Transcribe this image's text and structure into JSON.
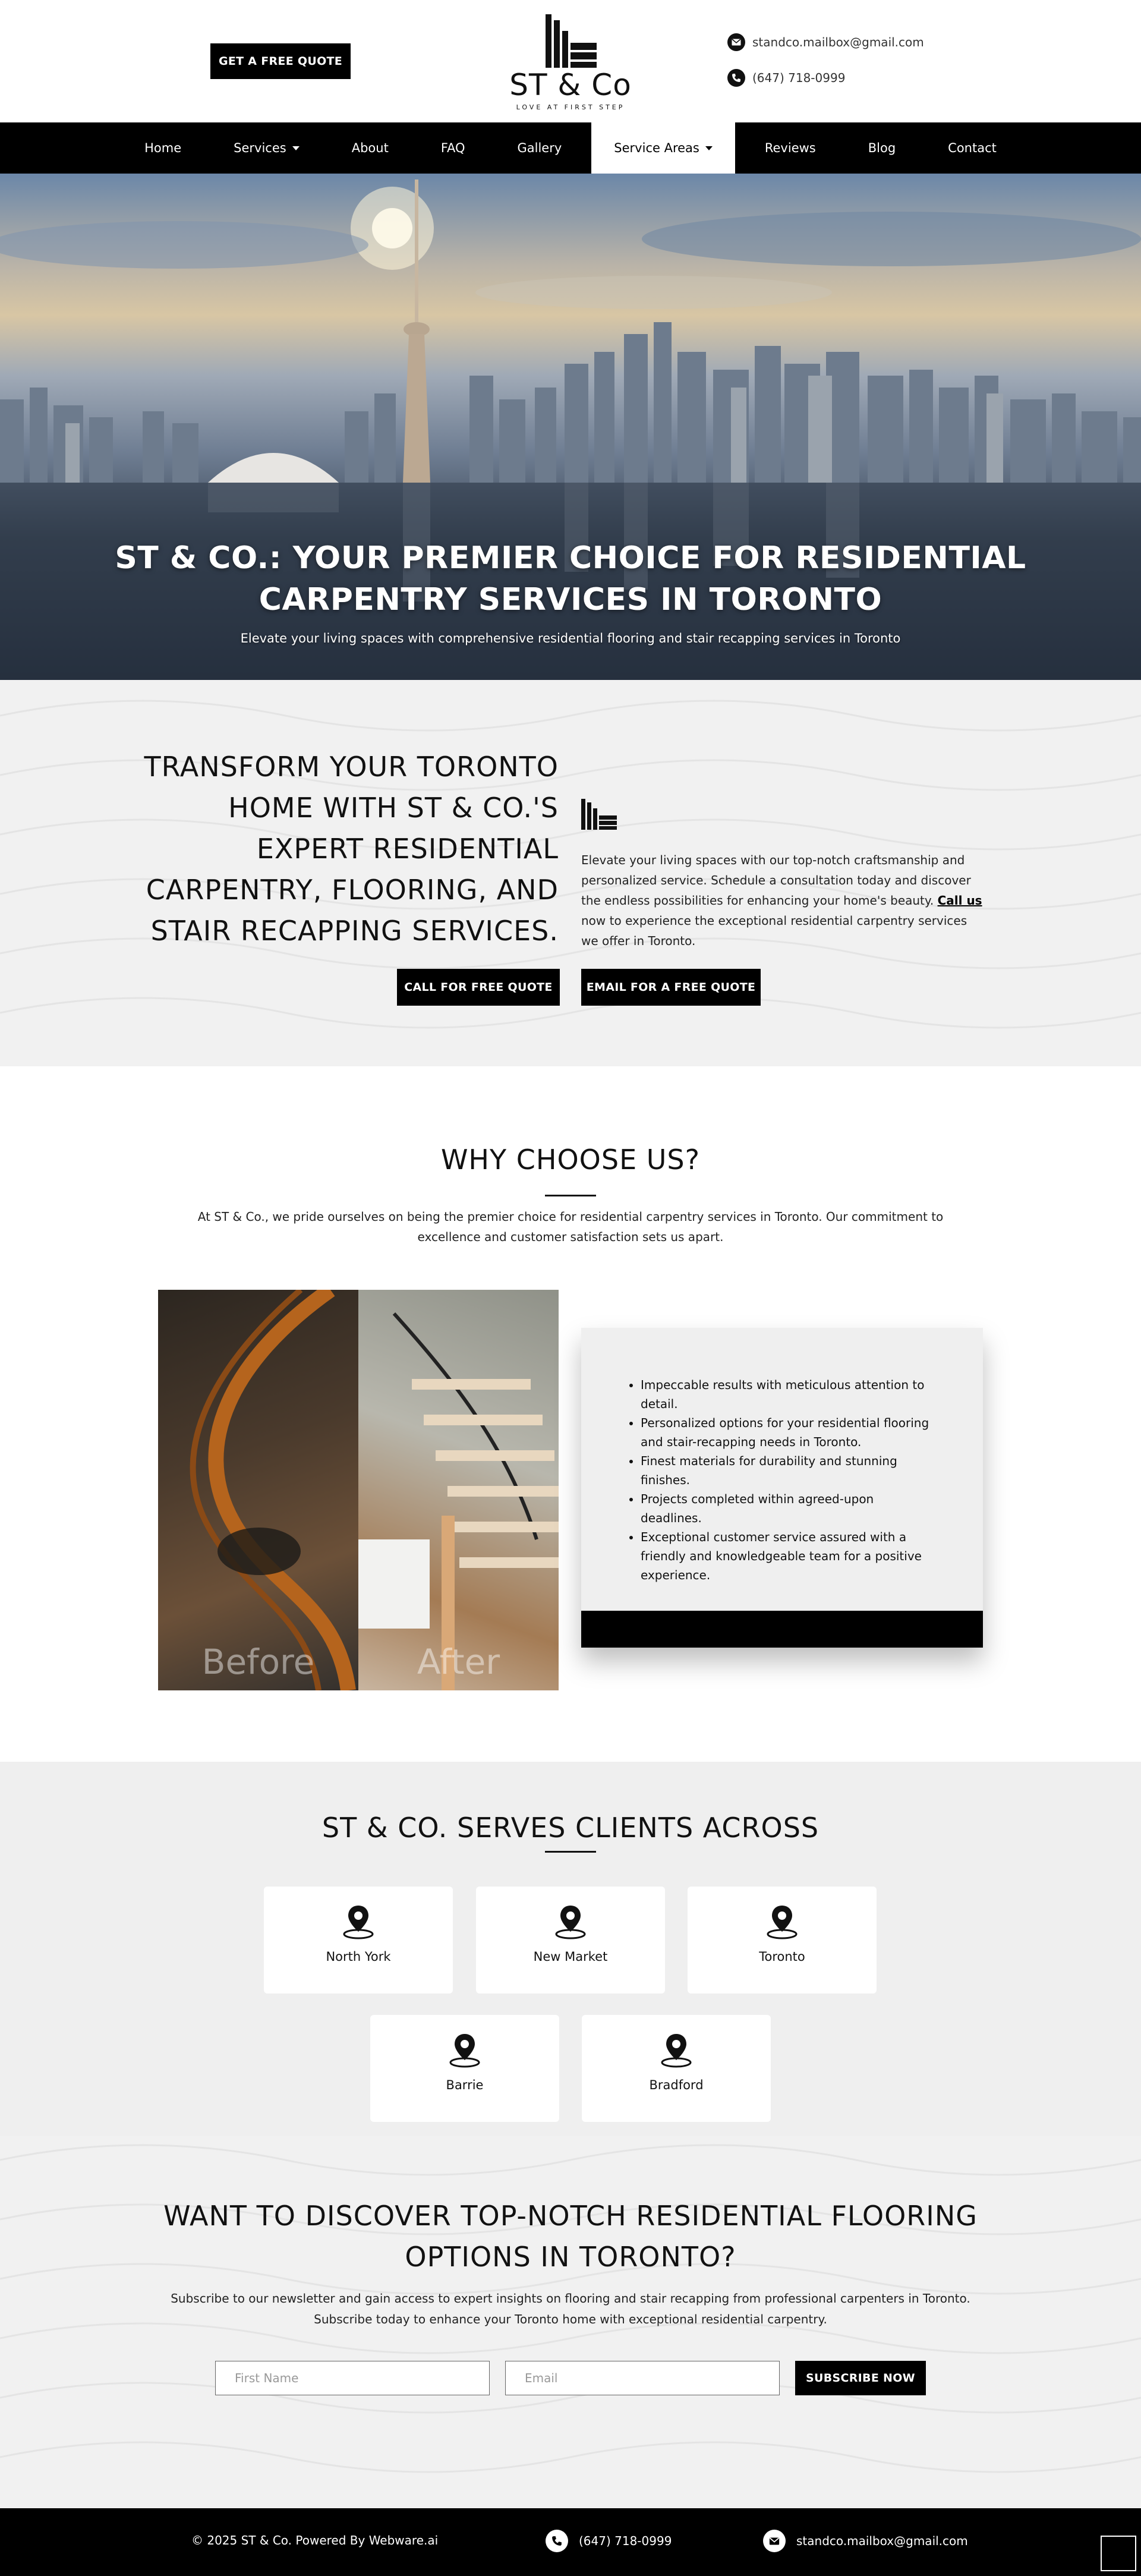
{
  "header": {
    "quote_button": "GET A FREE QUOTE",
    "logo_name": "ST & Co",
    "logo_tagline": "LOVE AT FIRST STEP",
    "email": "standco.mailbox@gmail.com",
    "phone": "(647) 718-0999"
  },
  "nav": {
    "items": [
      {
        "label": "Home"
      },
      {
        "label": "Services"
      },
      {
        "label": "About"
      },
      {
        "label": "FAQ"
      },
      {
        "label": "Gallery"
      },
      {
        "label": "Service Areas"
      },
      {
        "label": "Reviews"
      },
      {
        "label": "Blog"
      },
      {
        "label": "Contact"
      }
    ]
  },
  "hero": {
    "title_line1": "ST & CO.: YOUR PREMIER CHOICE FOR RESIDENTIAL",
    "title_line2": "CARPENTRY SERVICES IN TORONTO",
    "subtitle": "Elevate your living spaces with comprehensive residential flooring and stair recapping services in Toronto"
  },
  "transform": {
    "title_lines": [
      "TRANSFORM YOUR TORONTO",
      "HOME WITH ST & CO.'S",
      "EXPERT RESIDENTIAL",
      "CARPENTRY, FLOORING, AND",
      "STAIR RECAPPING SERVICES."
    ],
    "body_before": "Elevate your living spaces with our top-notch craftsmanship and personalized service. Schedule a consultation today and discover the endless possibilities for enhancing your home's beauty. ",
    "body_link": "Call us",
    "body_after": " now to experience the exceptional residential carpentry services we offer in Toronto.",
    "call_button": "CALL FOR FREE QUOTE",
    "email_button": "EMAIL FOR A FREE QUOTE"
  },
  "why": {
    "title": "WHY CHOOSE US?",
    "intro": "At ST & Co., we pride ourselves on being the premier choice for residential carpentry services in Toronto. Our commitment to excellence and customer satisfaction sets us apart.",
    "image_before_label": "Before",
    "image_after_label": "After",
    "points": [
      "Impeccable results with meticulous attention to detail.",
      "Personalized options for your residential flooring and stair-recapping needs in Toronto.",
      "Finest materials for durability and stunning finishes.",
      "Projects completed within agreed-upon deadlines.",
      "Exceptional customer service assured with a friendly and knowledgeable team for a positive experience."
    ]
  },
  "serves": {
    "title": "ST & CO. SERVES CLIENTS ACROSS",
    "areas": [
      "North York",
      "New Market",
      "Toronto",
      "Barrie",
      "Bradford"
    ]
  },
  "subscribe": {
    "title_line1": "WANT TO DISCOVER TOP-NOTCH RESIDENTIAL FLOORING",
    "title_line2": "OPTIONS IN TORONTO?",
    "text_line1": "Subscribe to our newsletter and gain access to expert insights on flooring and stair recapping from professional carpenters in Toronto.",
    "text_line2": "Subscribe today to enhance your Toronto home with exceptional residential carpentry.",
    "first_name_placeholder": "First Name",
    "email_placeholder": "Email",
    "button": "SUBSCRIBE NOW"
  },
  "footer": {
    "copyright": "© 2025 ST & Co. Powered By Webware.ai",
    "phone": "(647) 718-0999",
    "email": "standco.mailbox@gmail.com"
  },
  "colors": {
    "black": "#000000",
    "light_gray": "#efefef"
  }
}
